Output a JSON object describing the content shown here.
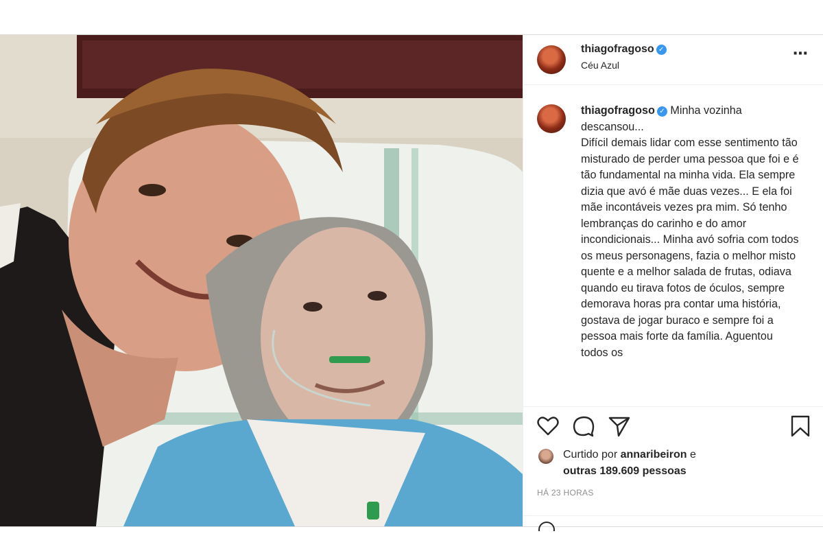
{
  "header": {
    "username": "thiagofragoso",
    "verified_mark": "✓",
    "location": "Céu Azul",
    "more_icon": "⋯"
  },
  "caption": {
    "username": "thiagofragoso",
    "verified_mark": "✓",
    "text": "Minha vozinha descansou...\nDifícil demais lidar com esse sentimento tão misturado de perder uma pessoa que foi e é tão fundamental na minha vida. Ela sempre dizia que avó é mãe duas vezes... E ela foi mãe incontáveis vezes pra mim. Só tenho lembranças do carinho e do amor incondicionais... Minha avó sofria com todos os meus personagens, fazia o melhor misto quente e a melhor salada de frutas, odiava quando eu tirava fotos de óculos, sempre demorava horas pra contar uma história, gostava de jogar buraco e sempre foi a pessoa mais forte da família. Aguentou todos os"
  },
  "actions": {
    "icons": [
      "heart-icon",
      "comment-icon",
      "share-icon",
      "bookmark-icon"
    ]
  },
  "likes": {
    "prefix": "Curtido por ",
    "user": "annaribeiron",
    "connector": " e",
    "others": "outras 189.609 pessoas"
  },
  "timestamp": "HÁ 23 HORAS",
  "colors": {
    "text": "#262626",
    "muted": "#8e8e8e",
    "verified": "#3897f0",
    "border": "#dbdbdb"
  }
}
